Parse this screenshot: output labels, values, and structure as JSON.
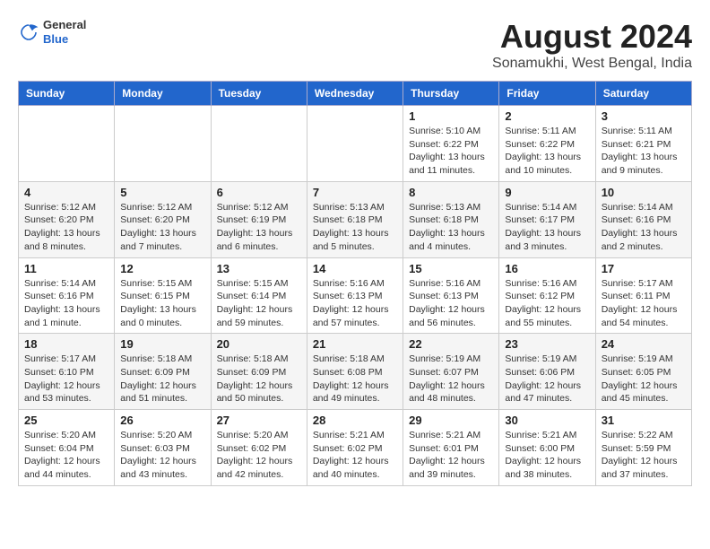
{
  "header": {
    "logo_general": "General",
    "logo_blue": "Blue",
    "month_year": "August 2024",
    "location": "Sonamukhi, West Bengal, India"
  },
  "weekdays": [
    "Sunday",
    "Monday",
    "Tuesday",
    "Wednesday",
    "Thursday",
    "Friday",
    "Saturday"
  ],
  "weeks": [
    [
      {
        "day": "",
        "info": ""
      },
      {
        "day": "",
        "info": ""
      },
      {
        "day": "",
        "info": ""
      },
      {
        "day": "",
        "info": ""
      },
      {
        "day": "1",
        "info": "Sunrise: 5:10 AM\nSunset: 6:22 PM\nDaylight: 13 hours\nand 11 minutes."
      },
      {
        "day": "2",
        "info": "Sunrise: 5:11 AM\nSunset: 6:22 PM\nDaylight: 13 hours\nand 10 minutes."
      },
      {
        "day": "3",
        "info": "Sunrise: 5:11 AM\nSunset: 6:21 PM\nDaylight: 13 hours\nand 9 minutes."
      }
    ],
    [
      {
        "day": "4",
        "info": "Sunrise: 5:12 AM\nSunset: 6:20 PM\nDaylight: 13 hours\nand 8 minutes."
      },
      {
        "day": "5",
        "info": "Sunrise: 5:12 AM\nSunset: 6:20 PM\nDaylight: 13 hours\nand 7 minutes."
      },
      {
        "day": "6",
        "info": "Sunrise: 5:12 AM\nSunset: 6:19 PM\nDaylight: 13 hours\nand 6 minutes."
      },
      {
        "day": "7",
        "info": "Sunrise: 5:13 AM\nSunset: 6:18 PM\nDaylight: 13 hours\nand 5 minutes."
      },
      {
        "day": "8",
        "info": "Sunrise: 5:13 AM\nSunset: 6:18 PM\nDaylight: 13 hours\nand 4 minutes."
      },
      {
        "day": "9",
        "info": "Sunrise: 5:14 AM\nSunset: 6:17 PM\nDaylight: 13 hours\nand 3 minutes."
      },
      {
        "day": "10",
        "info": "Sunrise: 5:14 AM\nSunset: 6:16 PM\nDaylight: 13 hours\nand 2 minutes."
      }
    ],
    [
      {
        "day": "11",
        "info": "Sunrise: 5:14 AM\nSunset: 6:16 PM\nDaylight: 13 hours\nand 1 minute."
      },
      {
        "day": "12",
        "info": "Sunrise: 5:15 AM\nSunset: 6:15 PM\nDaylight: 13 hours\nand 0 minutes."
      },
      {
        "day": "13",
        "info": "Sunrise: 5:15 AM\nSunset: 6:14 PM\nDaylight: 12 hours\nand 59 minutes."
      },
      {
        "day": "14",
        "info": "Sunrise: 5:16 AM\nSunset: 6:13 PM\nDaylight: 12 hours\nand 57 minutes."
      },
      {
        "day": "15",
        "info": "Sunrise: 5:16 AM\nSunset: 6:13 PM\nDaylight: 12 hours\nand 56 minutes."
      },
      {
        "day": "16",
        "info": "Sunrise: 5:16 AM\nSunset: 6:12 PM\nDaylight: 12 hours\nand 55 minutes."
      },
      {
        "day": "17",
        "info": "Sunrise: 5:17 AM\nSunset: 6:11 PM\nDaylight: 12 hours\nand 54 minutes."
      }
    ],
    [
      {
        "day": "18",
        "info": "Sunrise: 5:17 AM\nSunset: 6:10 PM\nDaylight: 12 hours\nand 53 minutes."
      },
      {
        "day": "19",
        "info": "Sunrise: 5:18 AM\nSunset: 6:09 PM\nDaylight: 12 hours\nand 51 minutes."
      },
      {
        "day": "20",
        "info": "Sunrise: 5:18 AM\nSunset: 6:09 PM\nDaylight: 12 hours\nand 50 minutes."
      },
      {
        "day": "21",
        "info": "Sunrise: 5:18 AM\nSunset: 6:08 PM\nDaylight: 12 hours\nand 49 minutes."
      },
      {
        "day": "22",
        "info": "Sunrise: 5:19 AM\nSunset: 6:07 PM\nDaylight: 12 hours\nand 48 minutes."
      },
      {
        "day": "23",
        "info": "Sunrise: 5:19 AM\nSunset: 6:06 PM\nDaylight: 12 hours\nand 47 minutes."
      },
      {
        "day": "24",
        "info": "Sunrise: 5:19 AM\nSunset: 6:05 PM\nDaylight: 12 hours\nand 45 minutes."
      }
    ],
    [
      {
        "day": "25",
        "info": "Sunrise: 5:20 AM\nSunset: 6:04 PM\nDaylight: 12 hours\nand 44 minutes."
      },
      {
        "day": "26",
        "info": "Sunrise: 5:20 AM\nSunset: 6:03 PM\nDaylight: 12 hours\nand 43 minutes."
      },
      {
        "day": "27",
        "info": "Sunrise: 5:20 AM\nSunset: 6:02 PM\nDaylight: 12 hours\nand 42 minutes."
      },
      {
        "day": "28",
        "info": "Sunrise: 5:21 AM\nSunset: 6:02 PM\nDaylight: 12 hours\nand 40 minutes."
      },
      {
        "day": "29",
        "info": "Sunrise: 5:21 AM\nSunset: 6:01 PM\nDaylight: 12 hours\nand 39 minutes."
      },
      {
        "day": "30",
        "info": "Sunrise: 5:21 AM\nSunset: 6:00 PM\nDaylight: 12 hours\nand 38 minutes."
      },
      {
        "day": "31",
        "info": "Sunrise: 5:22 AM\nSunset: 5:59 PM\nDaylight: 12 hours\nand 37 minutes."
      }
    ]
  ]
}
